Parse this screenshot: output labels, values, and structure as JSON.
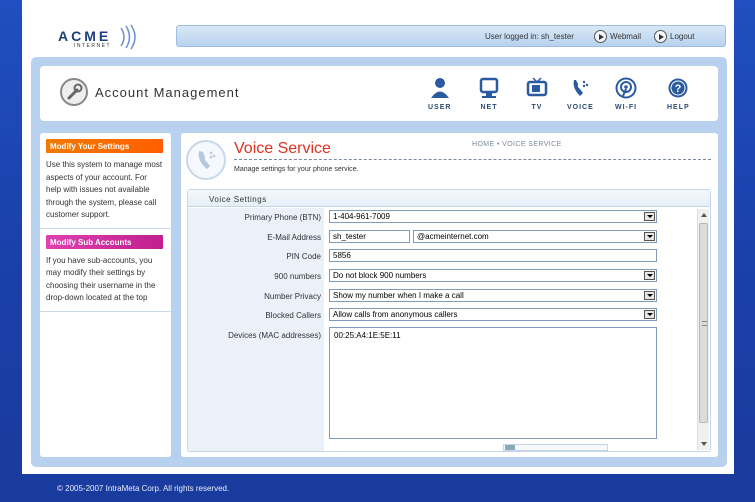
{
  "logo": {
    "name": "ACME",
    "sub": "INTERNET"
  },
  "topbar": {
    "login_text": "User logged in: sh_tester",
    "webmail_label": "Webmail",
    "logout_label": "Logout"
  },
  "header": {
    "title": "Account Management",
    "nav": [
      {
        "label": "USER",
        "icon": "user-icon"
      },
      {
        "label": "NET",
        "icon": "net-icon"
      },
      {
        "label": "TV",
        "icon": "tv-icon"
      },
      {
        "label": "VOICE",
        "icon": "voice-icon"
      },
      {
        "label": "WI-FI",
        "icon": "wifi-icon"
      },
      {
        "label": "HELP",
        "icon": "help-icon"
      }
    ]
  },
  "sidebar": {
    "section1_title": "Modify Your Settings",
    "section1_text": "Use this system to manage most aspects of your account.  For help with issues not available through the system, please call customer support.",
    "section2_title": "Modify Sub Accounts",
    "section2_text": "If you have sub-accounts, you may modify their settings by choosing their username in the drop-down located at the top"
  },
  "main": {
    "title": "Voice Service",
    "breadcrumb": "HOME • VOICE SERVICE",
    "subtitle": "Manage settings for your phone service.",
    "settings_title": "Voice Settings",
    "fields": {
      "primary_phone_label": "Primary Phone (BTN)",
      "primary_phone_value": "1-404-961-7009",
      "email_label": "E-Mail Address",
      "email_user": "sh_tester",
      "email_domain": "@acmeinternet.com",
      "pin_label": "PIN Code",
      "pin_value": "5856",
      "n900_label": "900 numbers",
      "n900_value": "Do not block 900 numbers",
      "privacy_label": "Number Privacy",
      "privacy_value": "Show my number when I make a call",
      "blocked_label": "Blocked Callers",
      "blocked_value": "Allow calls from anonymous callers",
      "devices_label": "Devices (MAC addresses)",
      "devices_value": "00:25:A4:1E:5E:11"
    }
  },
  "footer": {
    "copyright": "© 2005-2007 IntraMeta Corp. All rights reserved."
  },
  "colors": {
    "accent_red": "#e0301e",
    "orange": "#f07a00",
    "magenta": "#d0309e",
    "nav_blue": "#2a4a72"
  }
}
